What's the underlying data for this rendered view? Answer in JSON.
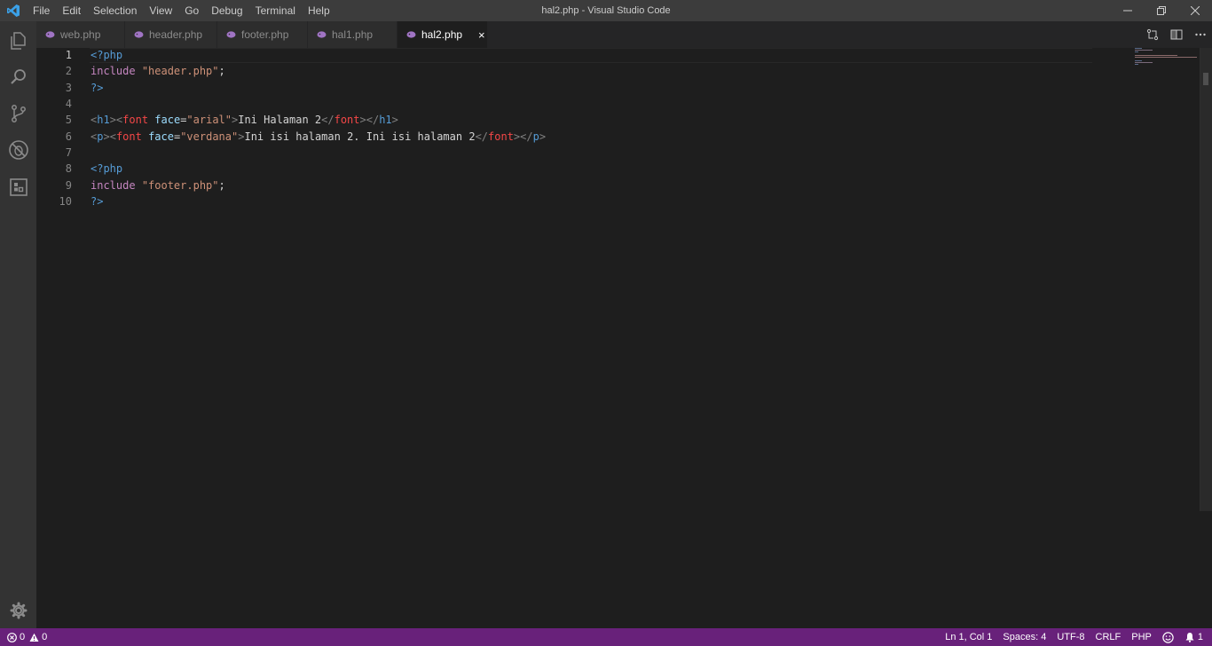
{
  "window": {
    "title": "hal2.php - Visual Studio Code"
  },
  "menu": [
    "File",
    "Edit",
    "Selection",
    "View",
    "Go",
    "Debug",
    "Terminal",
    "Help"
  ],
  "tabs": [
    {
      "label": "web.php",
      "active": false
    },
    {
      "label": "header.php",
      "active": false
    },
    {
      "label": "footer.php",
      "active": false
    },
    {
      "label": "hal1.php",
      "active": false
    },
    {
      "label": "hal2.php",
      "active": true
    }
  ],
  "tab_close_glyph": "×",
  "icons": {
    "app": "vscode-logo-icon",
    "activity": [
      "explorer-icon",
      "search-icon",
      "source-control-icon",
      "debug-icon",
      "extensions-icon"
    ],
    "settings": "gear-icon",
    "tab": "php-elephant-icon"
  },
  "colors": {
    "statusbar": "#68217a",
    "titlebar": "#3c3c3c",
    "editor_bg": "#1e1e1e",
    "activity_bg": "#333333"
  },
  "editor": {
    "line_numbers": [
      "1",
      "2",
      "3",
      "4",
      "5",
      "6",
      "7",
      "8",
      "9",
      "10"
    ],
    "current_line": "1",
    "lines": [
      "<?php",
      "include \"header.php\";",
      "?>",
      "",
      "<h1><font face=\"arial\">Ini Halaman 2</font></h1>",
      "<p><font face=\"verdana\">Ini isi halaman 2. Ini isi halaman 2</font></p>",
      "",
      "<?php",
      "include \"footer.php\";",
      "?>"
    ]
  },
  "statusbar": {
    "errors": "0",
    "warnings": "0",
    "position": "Ln 1, Col 1",
    "spaces": "Spaces: 4",
    "encoding": "UTF-8",
    "eol": "CRLF",
    "language": "PHP",
    "notifications": "1"
  }
}
